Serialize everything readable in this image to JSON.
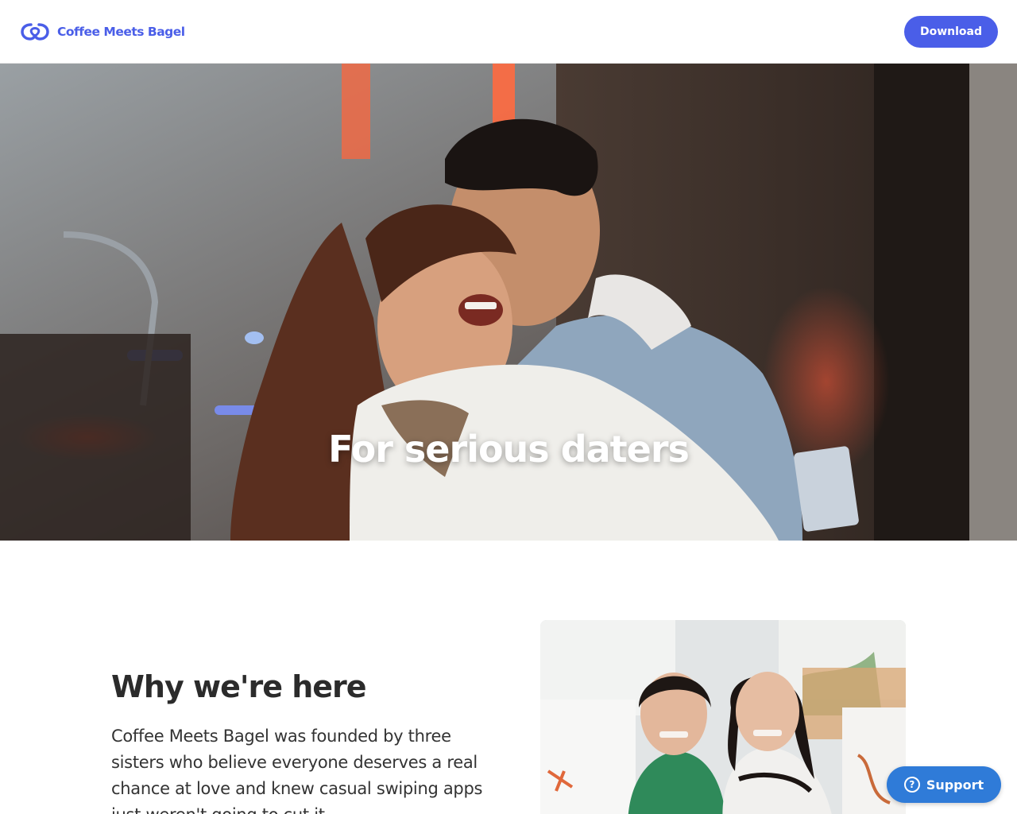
{
  "header": {
    "brand_name": "Coffee Meets Bagel",
    "download_label": "Download"
  },
  "hero": {
    "title": "For serious daters"
  },
  "about": {
    "heading": "Why we're here",
    "body": "Coffee Meets Bagel was founded by three sisters who believe everyone deserves a real chance at love and knew casual swiping apps just weren't going to cut it."
  },
  "support": {
    "label": "Support",
    "icon_glyph": "?"
  },
  "colors": {
    "brand": "#4a5ee8",
    "support": "#2f7bd8",
    "text": "#2b2b2b"
  }
}
